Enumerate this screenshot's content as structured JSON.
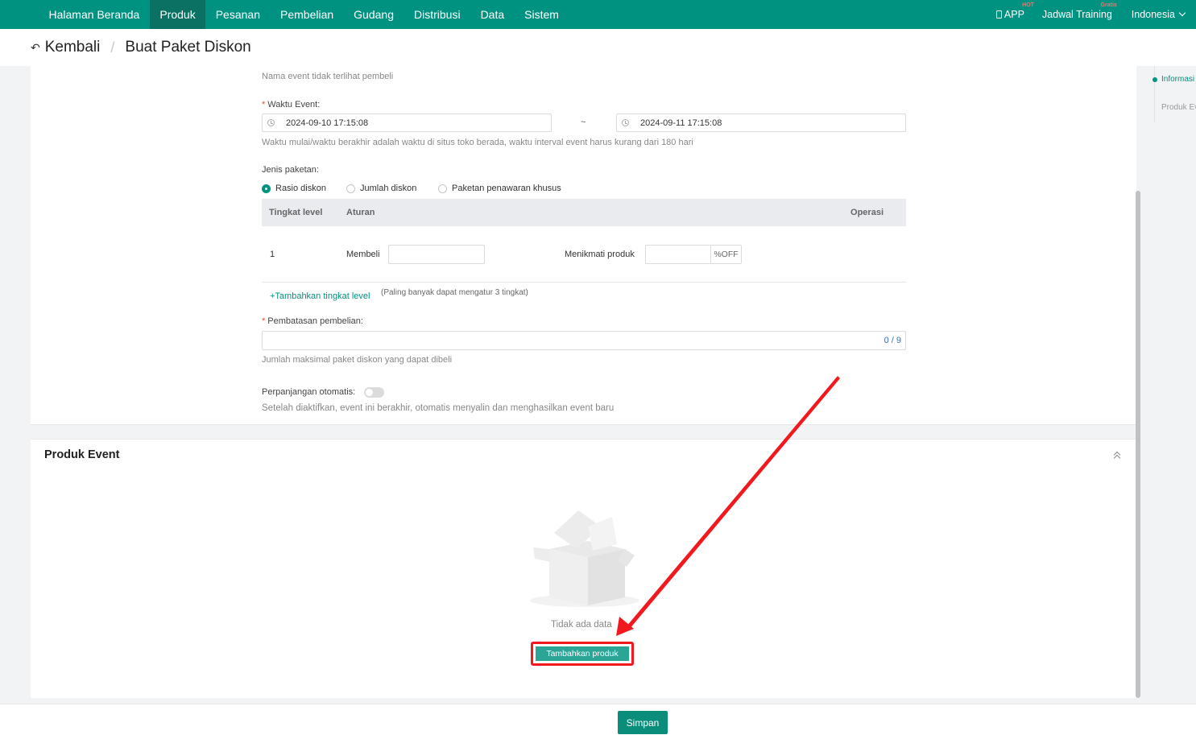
{
  "topnav": {
    "menu": [
      "Halaman Beranda",
      "Produk",
      "Pesanan",
      "Pembelian",
      "Gudang",
      "Distribusi",
      "Data",
      "Sistem"
    ],
    "active": "Produk",
    "app_label": "APP",
    "app_badge": "HOT",
    "training_label": "Jadwal Training",
    "training_badge": "Gratis",
    "language": "Indonesia"
  },
  "header": {
    "back_label": "Kembali",
    "separator": "/",
    "page_title": "Buat Paket Diskon"
  },
  "form": {
    "name_hint": "Nama event tidak terlihat pembeli",
    "time_label": "Waktu Event:",
    "start_time": "2024-09-10 17:15:08",
    "time_separator": "~",
    "end_time": "2024-09-11 17:15:08",
    "time_hint": "Waktu mulai/waktu berakhir adalah waktu di situs toko berada, waktu interval event harus kurang dari 180 hari",
    "package_type_label": "Jenis paketan:",
    "package_types": [
      "Rasio diskon",
      "Jumlah diskon",
      "Paketan penawaran khusus"
    ],
    "package_selected": "Rasio diskon",
    "table": {
      "headers": [
        "Tingkat level",
        "Aturan",
        "Operasi"
      ],
      "row": {
        "level": "1",
        "buy_label": "Membeli",
        "enjoy_label": "Menikmati produk",
        "suffix": "%OFF"
      }
    },
    "add_level_label": "+Tambahkan tingkat level",
    "add_level_hint": "(Paling banyak dapat mengatur 3 tingkat)",
    "purchase_limit_label": "Pembatasan pembelian:",
    "purchase_limit_counter": "0 / 9",
    "purchase_limit_hint": "Jumlah maksimal paket diskon yang dapat dibeli",
    "auto_renew_label": "Perpanjangan otomatis:",
    "auto_renew_on": false,
    "auto_renew_hint": "Setelah diaktifkan, event ini berakhir, otomatis menyalin dan menghasilkan event baru"
  },
  "products": {
    "title": "Produk Event",
    "empty_text": "Tidak ada data",
    "add_button": "Tambahkan produk"
  },
  "anchor": {
    "items": [
      "Informasi",
      "Produk Event"
    ],
    "active": "Informasi"
  },
  "footer": {
    "save_label": "Simpan"
  },
  "colors": {
    "brand": "#009281",
    "nav_active": "#0b7263",
    "annotation": "#f1191d"
  }
}
